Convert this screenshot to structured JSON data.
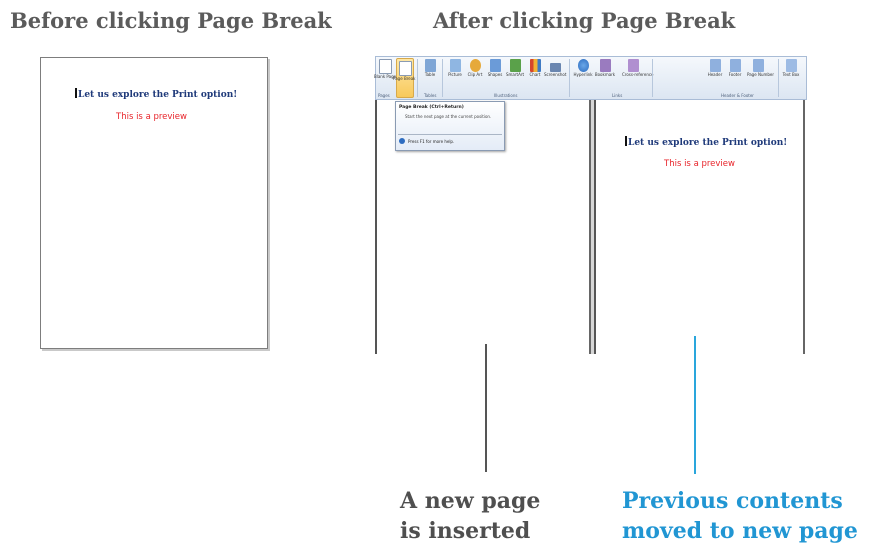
{
  "headings": {
    "before": "Before clicking Page Break",
    "after": "After clicking Page Break"
  },
  "document": {
    "title": "Let us explore the Print option!",
    "subtitle": "This is a preview"
  },
  "ribbon": {
    "buttons": [
      {
        "label": "Blank Page",
        "icon": "blank-page-icon",
        "color": "#ffffff"
      },
      {
        "label": "Page Break",
        "icon": "page-break-icon",
        "color": "#ffffff"
      },
      {
        "label": "Table",
        "icon": "table-icon",
        "color": "#7fa6d6"
      },
      {
        "label": "Picture",
        "icon": "picture-icon",
        "color": "#8fb6e2"
      },
      {
        "label": "Clip Art",
        "icon": "clip-art-icon",
        "color": "#e6a93b"
      },
      {
        "label": "Shapes",
        "icon": "shapes-icon",
        "color": "#6b9bd8"
      },
      {
        "label": "SmartArt",
        "icon": "smartart-icon",
        "color": "#5aa14a"
      },
      {
        "label": "Chart",
        "icon": "chart-icon",
        "color": "#d6452b"
      },
      {
        "label": "Screenshot",
        "icon": "screenshot-icon",
        "color": "#6a86b0"
      },
      {
        "label": "Hyperlink",
        "icon": "hyperlink-icon",
        "color": "#2d6cc0"
      },
      {
        "label": "Bookmark",
        "icon": "bookmark-icon",
        "color": "#9a7bbf"
      },
      {
        "label": "Cross-reference",
        "icon": "cross-reference-icon",
        "color": "#b08fd0"
      },
      {
        "label": "Header",
        "icon": "header-icon",
        "color": "#8fb0de"
      },
      {
        "label": "Footer",
        "icon": "footer-icon",
        "color": "#8fb0de"
      },
      {
        "label": "Page Number",
        "icon": "page-number-icon",
        "color": "#8fb0de"
      },
      {
        "label": "Text Box",
        "icon": "text-box-icon",
        "color": "#9dbbe4"
      }
    ],
    "groups": {
      "pages": "Pages",
      "tables": "Tables",
      "illustrations": "Illustrations",
      "links": "Links",
      "header_footer": "Header & Footer"
    }
  },
  "tooltip": {
    "title": "Page Break (Ctrl+Return)",
    "description": "Start the next page at the current position.",
    "help": "Press F1 for more help."
  },
  "captions": {
    "new_page": [
      "A new page",
      "is inserted"
    ],
    "moved": [
      "Previous contents",
      "moved to new page"
    ]
  },
  "colors": {
    "heading": "#5b5b5b",
    "doc_title": "#1f3a7a",
    "doc_subtitle": "#e8252b",
    "caption_new_page": "#4f4f4f",
    "caption_moved": "#2196d3",
    "pointer_new_page": "#555555",
    "pointer_moved": "#2aa6dc"
  }
}
